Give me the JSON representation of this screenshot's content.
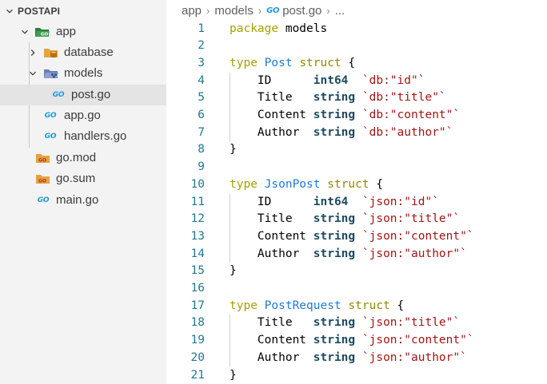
{
  "sidebar": {
    "root_label": "POSTAPI",
    "items": [
      {
        "label": "app",
        "icon": "go-folder-open-icon",
        "chevron": "chevron-down-icon"
      },
      {
        "label": "database",
        "icon": "database-folder-icon",
        "chevron": "chevron-right-icon"
      },
      {
        "label": "models",
        "icon": "models-folder-open-icon",
        "chevron": "chevron-down-icon"
      },
      {
        "label": "post.go",
        "icon": "go-file-icon",
        "selected": true
      },
      {
        "label": "app.go",
        "icon": "go-file-icon"
      },
      {
        "label": "handlers.go",
        "icon": "go-file-icon"
      },
      {
        "label": "go.mod",
        "icon": "go-mod-icon"
      },
      {
        "label": "go.sum",
        "icon": "go-mod-icon"
      },
      {
        "label": "main.go",
        "icon": "go-file-icon"
      }
    ]
  },
  "breadcrumb": {
    "parts": [
      "app",
      "models",
      "post.go",
      "..."
    ],
    "go_badge": "GO"
  },
  "editor": {
    "line_numbers": [
      "1",
      "2",
      "3",
      "4",
      "5",
      "6",
      "7",
      "8",
      "9",
      "10",
      "11",
      "12",
      "13",
      "14",
      "15",
      "16",
      "17",
      "18",
      "19",
      "20",
      "21"
    ],
    "lines": [
      [
        [
          "kw",
          "package"
        ],
        [
          "plain",
          " models"
        ]
      ],
      [],
      [
        [
          "kw",
          "type"
        ],
        [
          "plain",
          " "
        ],
        [
          "type",
          "Post"
        ],
        [
          "plain",
          " "
        ],
        [
          "kw2",
          "struct"
        ],
        [
          "plain",
          " {"
        ]
      ],
      [
        [
          "plain",
          "    ID      "
        ],
        [
          "prim",
          "int64"
        ],
        [
          "plain",
          "  "
        ],
        [
          "str",
          "`db:\"id\"`"
        ]
      ],
      [
        [
          "plain",
          "    Title   "
        ],
        [
          "prim",
          "string"
        ],
        [
          "plain",
          " "
        ],
        [
          "str",
          "`db:\"title\"`"
        ]
      ],
      [
        [
          "plain",
          "    Content "
        ],
        [
          "prim",
          "string"
        ],
        [
          "plain",
          " "
        ],
        [
          "str",
          "`db:\"content\"`"
        ]
      ],
      [
        [
          "plain",
          "    Author  "
        ],
        [
          "prim",
          "string"
        ],
        [
          "plain",
          " "
        ],
        [
          "str",
          "`db:\"author\"`"
        ]
      ],
      [
        [
          "plain",
          "}"
        ]
      ],
      [],
      [
        [
          "kw",
          "type"
        ],
        [
          "plain",
          " "
        ],
        [
          "type",
          "JsonPost"
        ],
        [
          "plain",
          " "
        ],
        [
          "kw2",
          "struct"
        ],
        [
          "plain",
          " {"
        ]
      ],
      [
        [
          "plain",
          "    ID      "
        ],
        [
          "prim",
          "int64"
        ],
        [
          "plain",
          "  "
        ],
        [
          "str",
          "`json:\"id\"`"
        ]
      ],
      [
        [
          "plain",
          "    Title   "
        ],
        [
          "prim",
          "string"
        ],
        [
          "plain",
          " "
        ],
        [
          "str",
          "`json:\"title\"`"
        ]
      ],
      [
        [
          "plain",
          "    Content "
        ],
        [
          "prim",
          "string"
        ],
        [
          "plain",
          " "
        ],
        [
          "str",
          "`json:\"content\"`"
        ]
      ],
      [
        [
          "plain",
          "    Author  "
        ],
        [
          "prim",
          "string"
        ],
        [
          "plain",
          " "
        ],
        [
          "str",
          "`json:\"author\"`"
        ]
      ],
      [
        [
          "plain",
          "}"
        ]
      ],
      [],
      [
        [
          "kw",
          "type"
        ],
        [
          "plain",
          " "
        ],
        [
          "type",
          "PostRequest"
        ],
        [
          "plain",
          " "
        ],
        [
          "kw2",
          "struct"
        ],
        [
          "plain",
          " {"
        ]
      ],
      [
        [
          "plain",
          "    Title   "
        ],
        [
          "prim",
          "string"
        ],
        [
          "plain",
          " "
        ],
        [
          "str",
          "`json:\"title\"`"
        ]
      ],
      [
        [
          "plain",
          "    Content "
        ],
        [
          "prim",
          "string"
        ],
        [
          "plain",
          " "
        ],
        [
          "str",
          "`json:\"content\"`"
        ]
      ],
      [
        [
          "plain",
          "    Author  "
        ],
        [
          "prim",
          "string"
        ],
        [
          "plain",
          " "
        ],
        [
          "str",
          "`json:\"author\"`"
        ]
      ],
      [
        [
          "plain",
          "}"
        ]
      ]
    ]
  },
  "colors": {
    "sidebar_bg": "#f3f3f3",
    "selected_bg": "#e4e4e4",
    "line_number": "#237893",
    "keyword": "#a4a100",
    "type_name": "#1f7bd1",
    "primitive": "#1f4a5e",
    "string": "#a31515",
    "go_blue": "#1e9bd7",
    "folder_green": "#3a8a4a",
    "folder_orange": "#e3a440"
  }
}
